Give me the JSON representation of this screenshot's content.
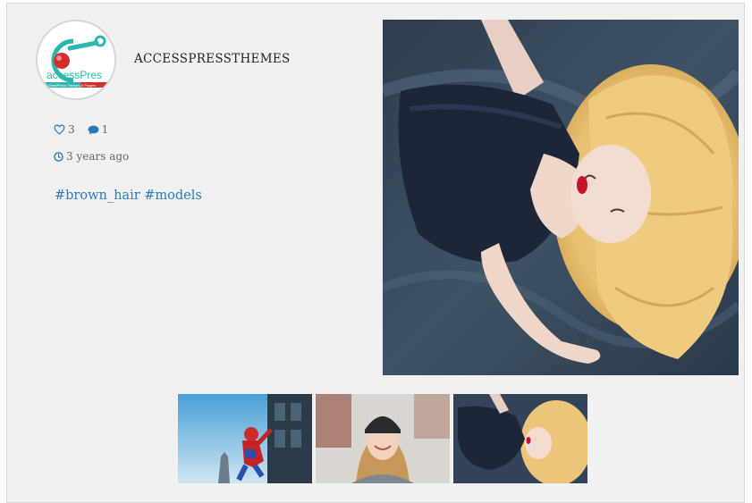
{
  "profile": {
    "username": "ACCESSPRESSTHEMES",
    "avatar_logo_text": "accessPres",
    "avatar_tagline": "WordPress Themes & Plugins"
  },
  "post": {
    "likes": "3",
    "comments": "1",
    "time_ago": "3 years ago",
    "tags": [
      "#brown_hair",
      "#models"
    ]
  },
  "icons": {
    "likes": "heart-outline-icon",
    "comments": "speech-bubble-icon",
    "time": "clock-icon"
  },
  "colors": {
    "accent": "#2a7ab8",
    "card_bg": "#f1f1f1",
    "logo_red": "#d32f2f",
    "logo_teal": "#2bb7b0"
  },
  "thumbnails": [
    {
      "subject": "spiderman"
    },
    {
      "subject": "woman-beanie"
    },
    {
      "subject": "blonde-woman",
      "active": true
    }
  ]
}
